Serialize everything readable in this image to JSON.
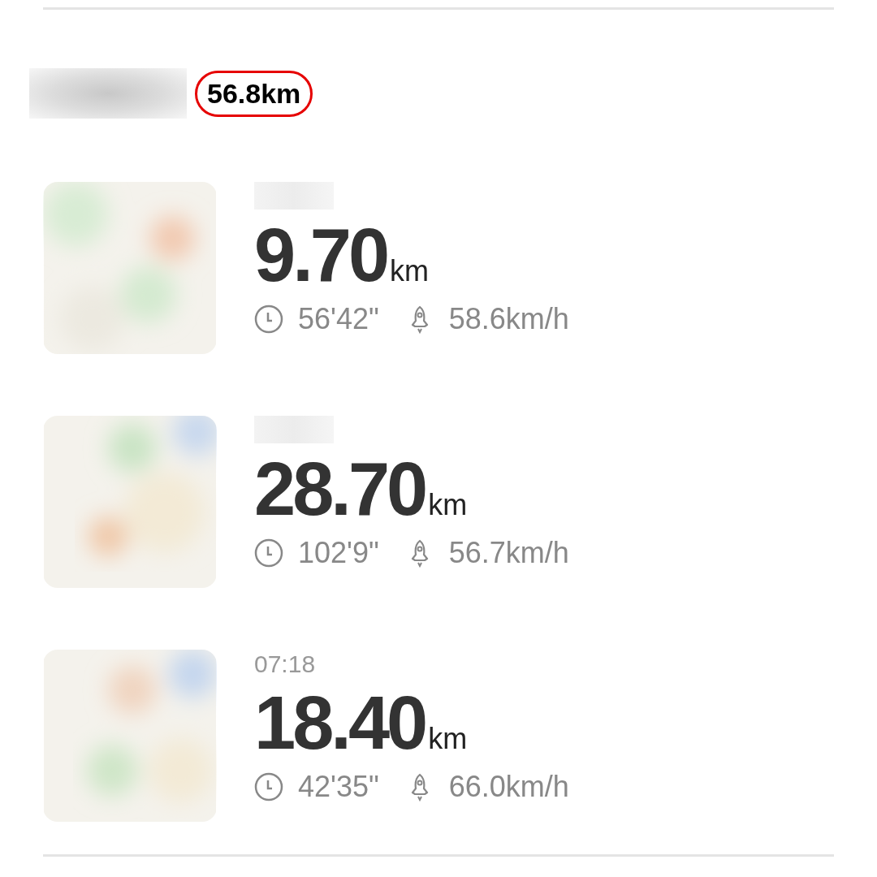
{
  "summary": {
    "total": "56.8km",
    "highlighted": true
  },
  "rides": [
    {
      "distance": "9.70",
      "unit": "km",
      "duration": "56'42\"",
      "speed": "58.6km/h"
    },
    {
      "distance": "28.70",
      "unit": "km",
      "duration": "102'9\"",
      "speed": "56.7km/h"
    },
    {
      "time": "07:18",
      "distance": "18.40",
      "unit": "km",
      "duration": "42'35\"",
      "speed": "66.0km/h"
    }
  ]
}
